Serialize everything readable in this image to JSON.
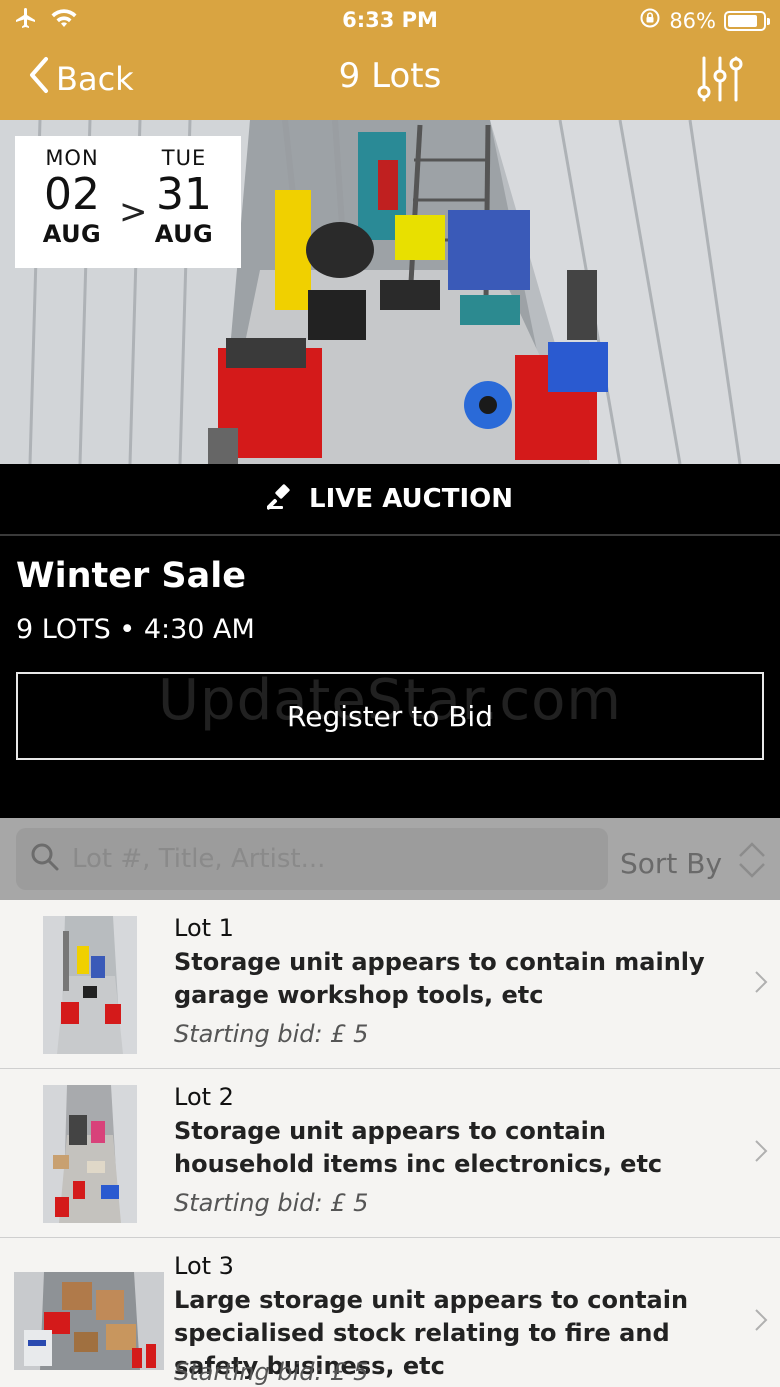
{
  "status_bar": {
    "time": "6:33 PM",
    "battery": "86%",
    "battery_level": 0.86
  },
  "nav": {
    "back_label": "Back",
    "title": "9 Lots"
  },
  "hero": {
    "start": {
      "dow": "MON",
      "day": "02",
      "month": "AUG"
    },
    "separator": ">",
    "end": {
      "dow": "TUE",
      "day": "31",
      "month": "AUG"
    }
  },
  "live_label": "LIVE AUCTION",
  "sale": {
    "name": "Winter Sale",
    "meta": "9 LOTS • 4:30 AM",
    "register_label": "Register to Bid",
    "watermark": "UpdateStar.com"
  },
  "search": {
    "placeholder": "Lot #, Title, Artist...",
    "sort_label": "Sort By"
  },
  "lots": [
    {
      "lot": "Lot 1",
      "title": "Storage unit appears to contain mainly garage workshop tools, etc",
      "bid": "Starting bid: £ 5"
    },
    {
      "lot": "Lot 2",
      "title": "Storage unit appears to contain household items inc electronics, etc",
      "bid": "Starting bid: £ 5"
    },
    {
      "lot": "Lot 3",
      "title": "Large storage unit appears to contain specialised stock relating to fire and safety business, etc",
      "bid": "Starting bid: £ 5"
    }
  ],
  "colors": {
    "brand": "#d9a441",
    "background": "#000000",
    "list_bg": "#f5f4f2"
  }
}
